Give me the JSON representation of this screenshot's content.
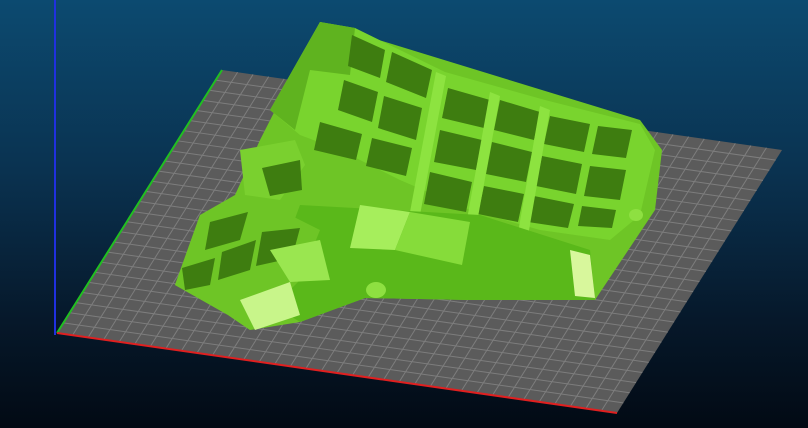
{
  "viewport": {
    "background_top": "#0c4a70",
    "background_bottom": "#020a14"
  },
  "build_plate": {
    "color": "#5b5b5b",
    "grid_color": "#7d7d7d"
  },
  "axes": {
    "x_color": "#e02020",
    "y_color": "#20c020",
    "z_color": "#2030e0"
  },
  "model": {
    "icon": "keyboard-case-3d-model",
    "color": "#76d12a",
    "highlight": "#c8f58a",
    "shadow": "#4d9a15"
  }
}
